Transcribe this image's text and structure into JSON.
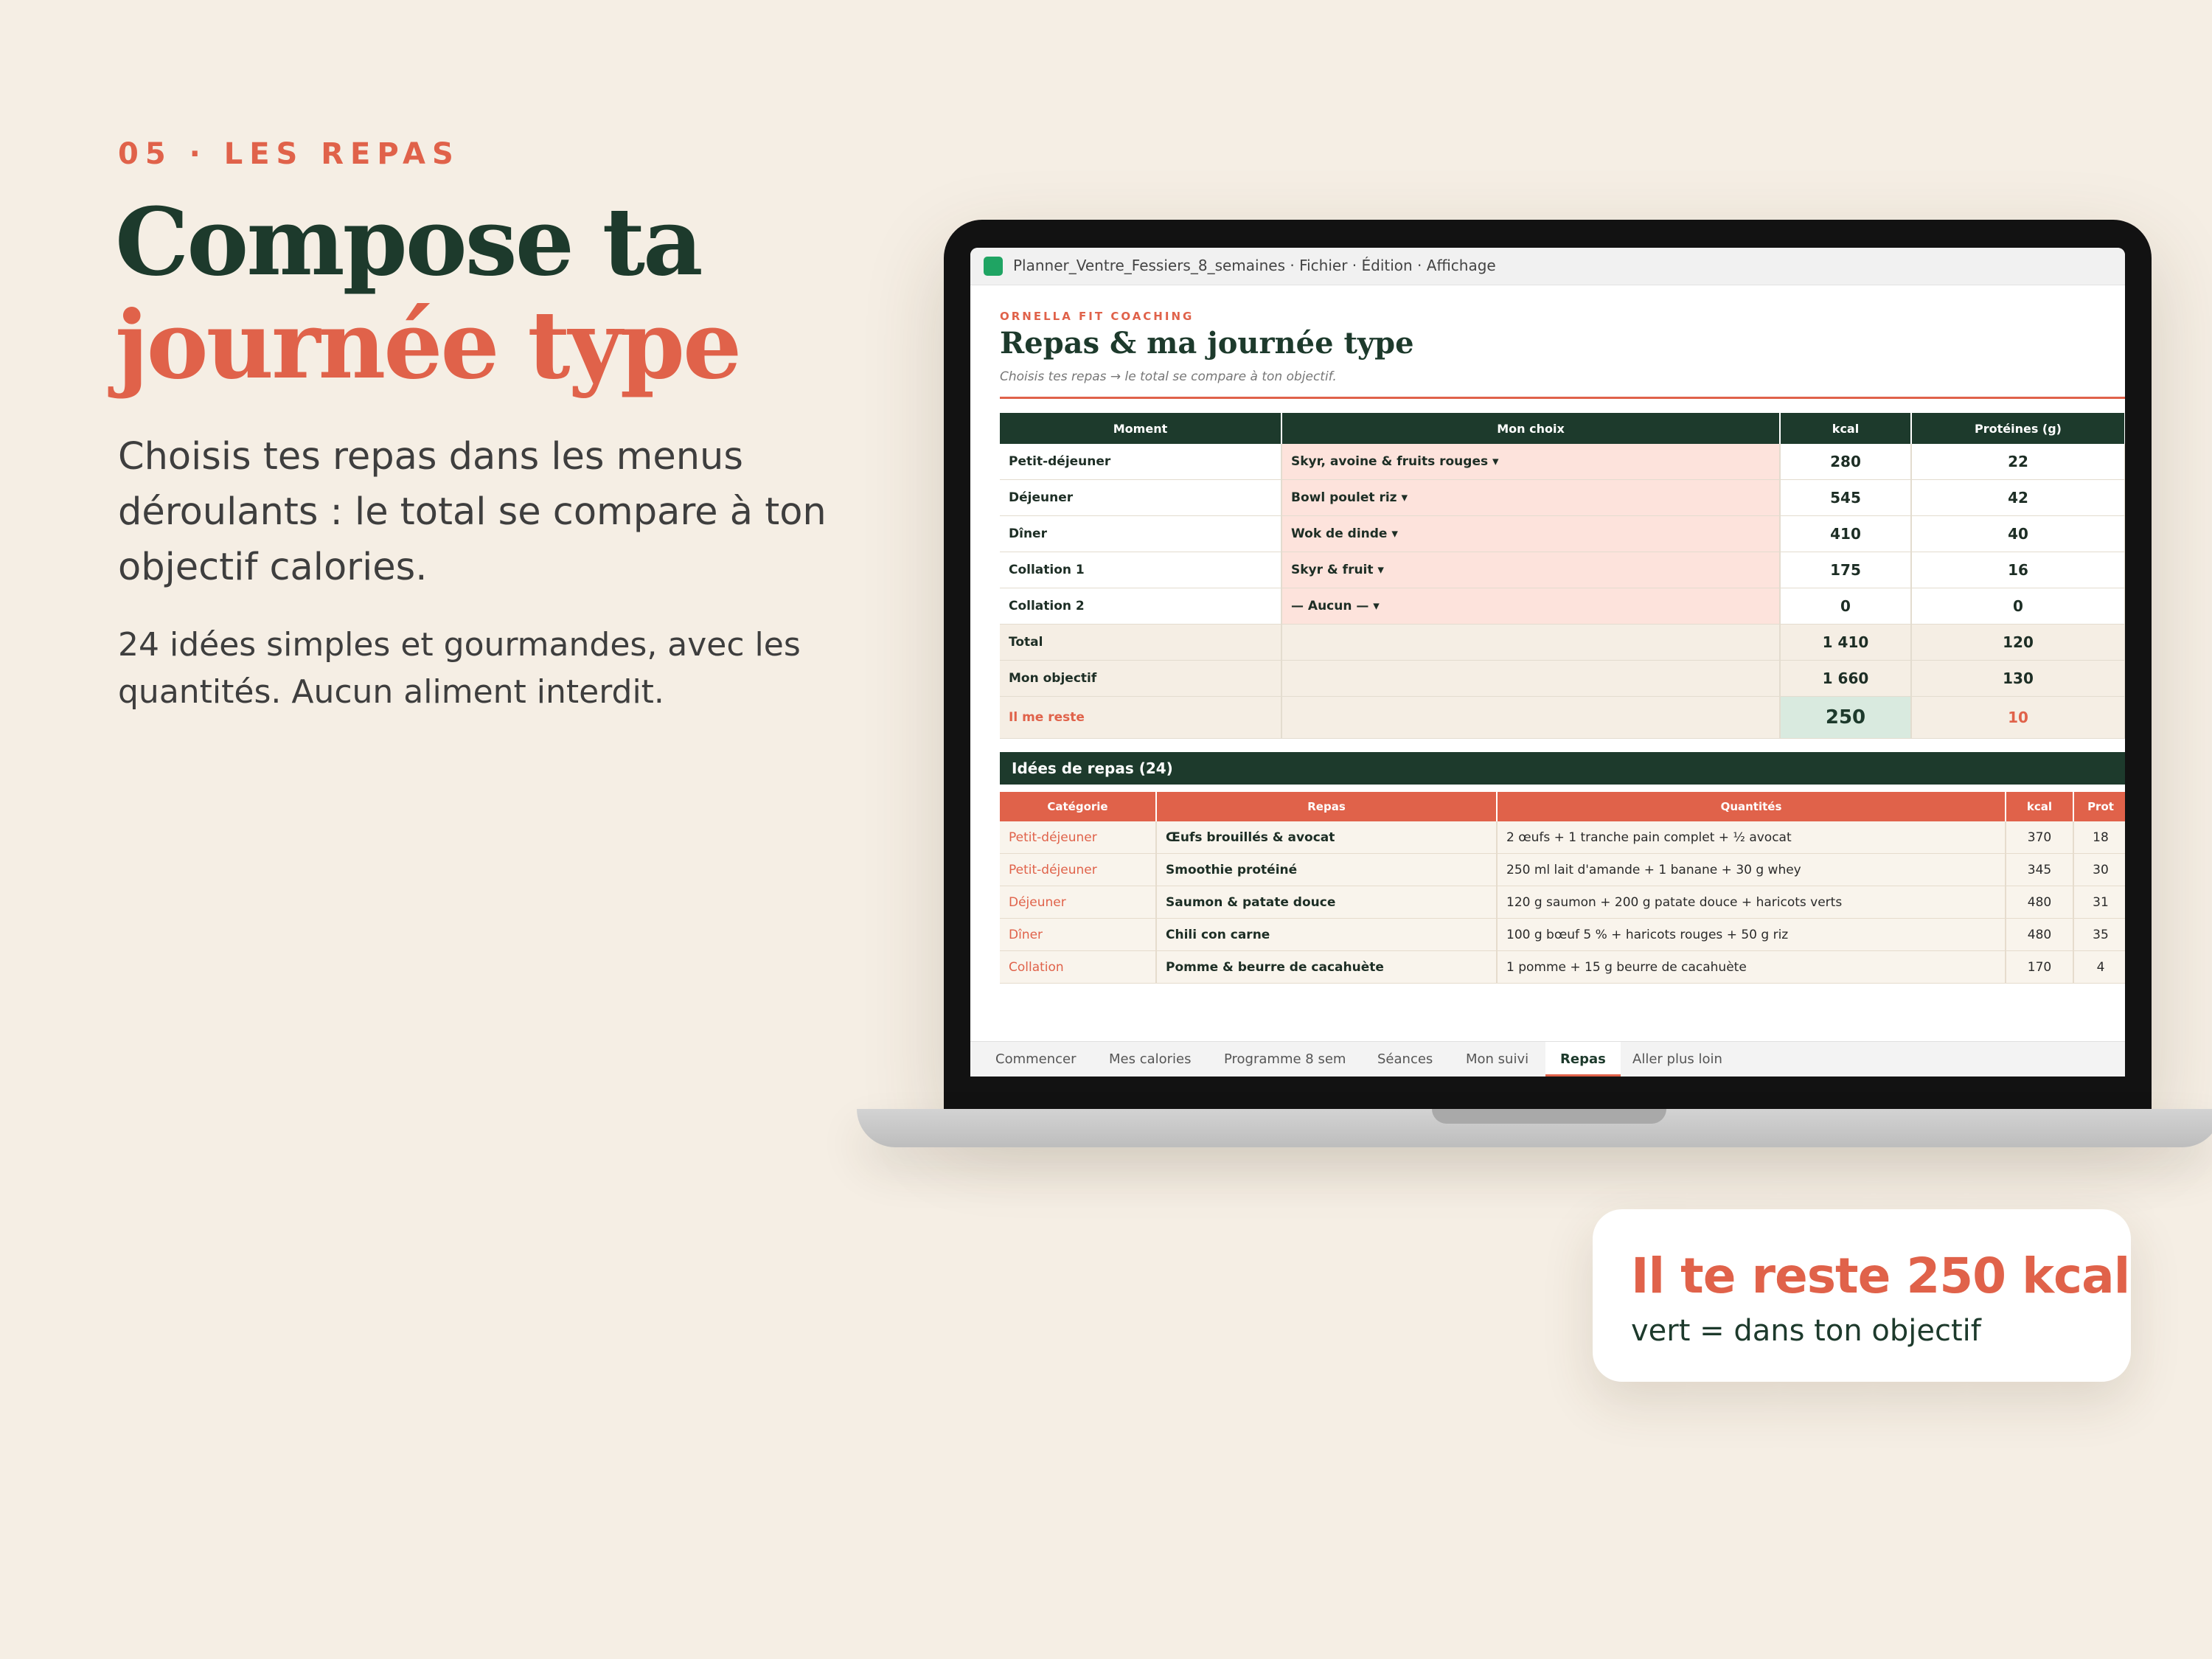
{
  "intro": {
    "kicker": "05 · LES REPAS",
    "headline_line1": "Compose ta",
    "headline_line2": "journée type",
    "lead": "Choisis tes repas dans les menus déroulants : le total se compare à ton objectif calories.",
    "sub": "24 idées simples et gourmandes, avec les quantités. Aucun aliment interdit."
  },
  "window": {
    "title": "Planner_Ventre_Fessiers_8_semaines · Fichier · Édition · Affichage",
    "icon": "spreadsheet-icon"
  },
  "sheet": {
    "brand": "ORNELLA FIT COACHING",
    "title": "Repas & ma journée type",
    "subtitle": "Choisis tes repas → le total se compare à ton objectif."
  },
  "summary": {
    "headers": [
      "Moment",
      "Mon choix",
      "kcal",
      "Protéines (g)"
    ],
    "rows": [
      {
        "moment": "Petit-déjeuner",
        "choice": "Skyr, avoine & fruits rouges ▾",
        "kcal": "280",
        "prot": "22"
      },
      {
        "moment": "Déjeuner",
        "choice": "Bowl poulet riz ▾",
        "kcal": "545",
        "prot": "42"
      },
      {
        "moment": "Dîner",
        "choice": "Wok de dinde ▾",
        "kcal": "410",
        "prot": "40"
      },
      {
        "moment": "Collation 1",
        "choice": "Skyr & fruit ▾",
        "kcal": "175",
        "prot": "16"
      },
      {
        "moment": "Collation 2",
        "choice": "— Aucun — ▾",
        "kcal": "0",
        "prot": "0"
      }
    ],
    "total": {
      "label": "Total",
      "kcal": "1 410",
      "prot": "120"
    },
    "goal": {
      "label": "Mon objectif",
      "kcal": "1 660",
      "prot": "130"
    },
    "remaining": {
      "label": "Il me reste",
      "kcal": "250",
      "prot": "10"
    }
  },
  "ideas": {
    "title": "Idées de repas (24)",
    "headers": [
      "Catégorie",
      "Repas",
      "Quantités",
      "kcal",
      "Prot"
    ],
    "rows": [
      {
        "cat": "Petit-déjeuner",
        "meal": "Œufs brouillés & avocat",
        "qty": "2 œufs + 1 tranche pain complet + ½ avocat",
        "kcal": "370",
        "prot": "18"
      },
      {
        "cat": "Petit-déjeuner",
        "meal": "Smoothie protéiné",
        "qty": "250 ml lait d'amande + 1 banane + 30 g whey",
        "kcal": "345",
        "prot": "30"
      },
      {
        "cat": "Déjeuner",
        "meal": "Saumon & patate douce",
        "qty": "120 g saumon + 200 g patate douce + haricots verts",
        "kcal": "480",
        "prot": "31"
      },
      {
        "cat": "Dîner",
        "meal": "Chili con carne",
        "qty": "100 g bœuf 5 % + haricots rouges + 50 g riz",
        "kcal": "480",
        "prot": "35"
      },
      {
        "cat": "Collation",
        "meal": "Pomme & beurre de cacahuète",
        "qty": "1 pomme + 15 g beurre de cacahuète",
        "kcal": "170",
        "prot": "4"
      }
    ]
  },
  "tabs": [
    {
      "label": "Commencer",
      "active": false
    },
    {
      "label": "Mes calories",
      "active": false
    },
    {
      "label": "Programme 8 sem",
      "active": false
    },
    {
      "label": "Séances",
      "active": false
    },
    {
      "label": "Mon suivi",
      "active": false
    },
    {
      "label": "Repas",
      "active": true
    },
    {
      "label": "Aller plus loin",
      "active": false
    }
  ],
  "callout": {
    "title": "Il te reste 250 kcal",
    "sub": "vert = dans ton objectif"
  },
  "colors": {
    "background": "#f5eee4",
    "accent": "#e0624a",
    "dark_green": "#1d3a2c",
    "choice_fill": "#fde3dc",
    "ok_fill": "#d9eadf"
  }
}
